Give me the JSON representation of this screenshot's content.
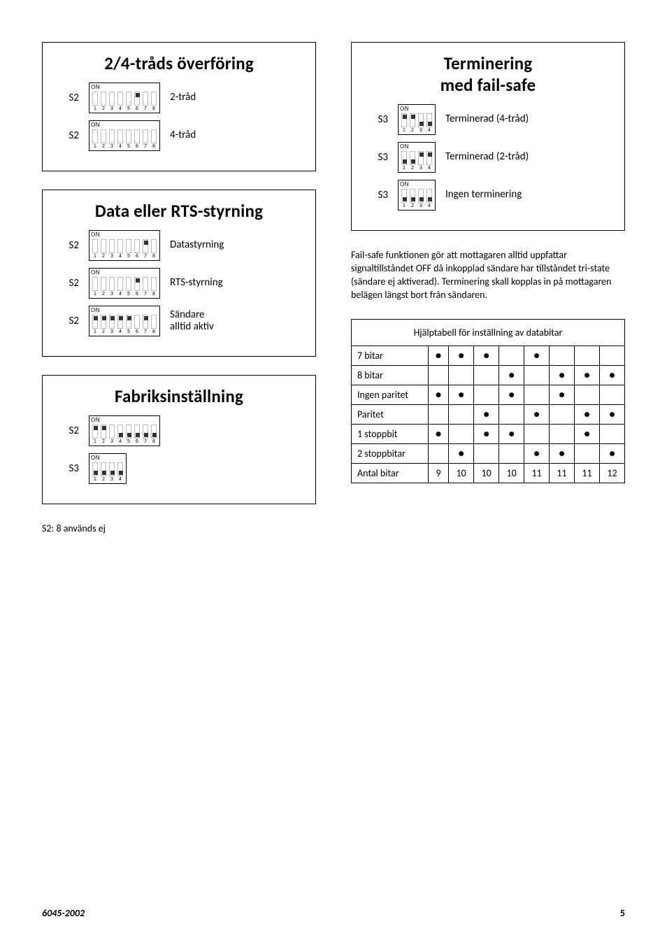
{
  "box1": {
    "title": "2/4-tråds överföring",
    "rows": [
      {
        "label": "S2",
        "switches": [
          0,
          0,
          0,
          0,
          0,
          1,
          0,
          0
        ],
        "desc": "2-tråd"
      },
      {
        "label": "S2",
        "switches": [
          0,
          0,
          0,
          0,
          0,
          0,
          0,
          0
        ],
        "desc": "4-tråd"
      }
    ]
  },
  "box2": {
    "title": "Data eller RTS-styrning",
    "rows": [
      {
        "label": "S2",
        "switches": [
          0,
          0,
          0,
          0,
          0,
          0,
          1,
          0
        ],
        "desc": "Datastyrning"
      },
      {
        "label": "S2",
        "switches": [
          0,
          0,
          0,
          0,
          0,
          1,
          0,
          0
        ],
        "desc": "RTS-styrning"
      },
      {
        "label": "S2",
        "switches": [
          1,
          1,
          1,
          1,
          1,
          0,
          1,
          0
        ],
        "desc": "Sändare\nalltid aktiv"
      }
    ]
  },
  "box3": {
    "title": "Fabriksinställning",
    "rows": [
      {
        "label": "S2",
        "switches": [
          1,
          1,
          0,
          0,
          0,
          0,
          0,
          0
        ],
        "switches_down_on": [
          0,
          0,
          0,
          1,
          1,
          1,
          1,
          1
        ],
        "desc": ""
      },
      {
        "label": "S3",
        "switches": [
          0,
          0,
          0,
          0
        ],
        "switches_down_on": [
          1,
          1,
          1,
          1
        ],
        "desc": ""
      }
    ]
  },
  "box4": {
    "title": "Terminering\nmed fail-safe",
    "rows": [
      {
        "label": "S3",
        "switches": [
          1,
          1,
          0,
          0
        ],
        "switches_down_on": [
          0,
          0,
          1,
          1
        ],
        "desc": "Terminerad (4-tråd)"
      },
      {
        "label": "S3",
        "switches": [
          0,
          0,
          1,
          1
        ],
        "switches_down_on": [
          1,
          1,
          0,
          0
        ],
        "desc": "Terminerad (2-tråd)"
      },
      {
        "label": "S3",
        "switches": [
          0,
          0,
          0,
          0
        ],
        "switches_down_on": [
          1,
          1,
          1,
          1
        ],
        "desc": "Ingen terminering"
      }
    ]
  },
  "paragraph": "Fail-safe funktionen gör att mottagaren alltid uppfattar signaltillståndet OFF då inkopplad sändare har tillståndet tri-state (sändare ej aktiverad). Terminering skall kopplas in på mottagaren belägen längst bort från sändaren.",
  "note": "S2: 8 används ej",
  "helper": {
    "caption": "Hjälptabell för inställning av databitar",
    "rows": [
      {
        "label": "7 bitar",
        "dots": [
          1,
          1,
          1,
          0,
          1,
          0,
          0,
          0
        ]
      },
      {
        "label": "8 bitar",
        "dots": [
          0,
          0,
          0,
          1,
          0,
          1,
          1,
          1
        ]
      },
      {
        "label": "Ingen paritet",
        "dots": [
          1,
          1,
          0,
          1,
          0,
          1,
          0,
          0
        ]
      },
      {
        "label": "Paritet",
        "dots": [
          0,
          0,
          1,
          0,
          1,
          0,
          1,
          1
        ]
      },
      {
        "label": "1 stoppbit",
        "dots": [
          1,
          0,
          1,
          1,
          0,
          0,
          1,
          0
        ]
      },
      {
        "label": "2 stoppbitar",
        "dots": [
          0,
          1,
          0,
          0,
          1,
          1,
          0,
          1
        ]
      }
    ],
    "footer": {
      "label": "Antal bitar",
      "vals": [
        "9",
        "10",
        "10",
        "10",
        "11",
        "11",
        "11",
        "12"
      ]
    }
  },
  "footer": {
    "docid": "6045-2002",
    "page": "5"
  },
  "dip_on": "ON"
}
